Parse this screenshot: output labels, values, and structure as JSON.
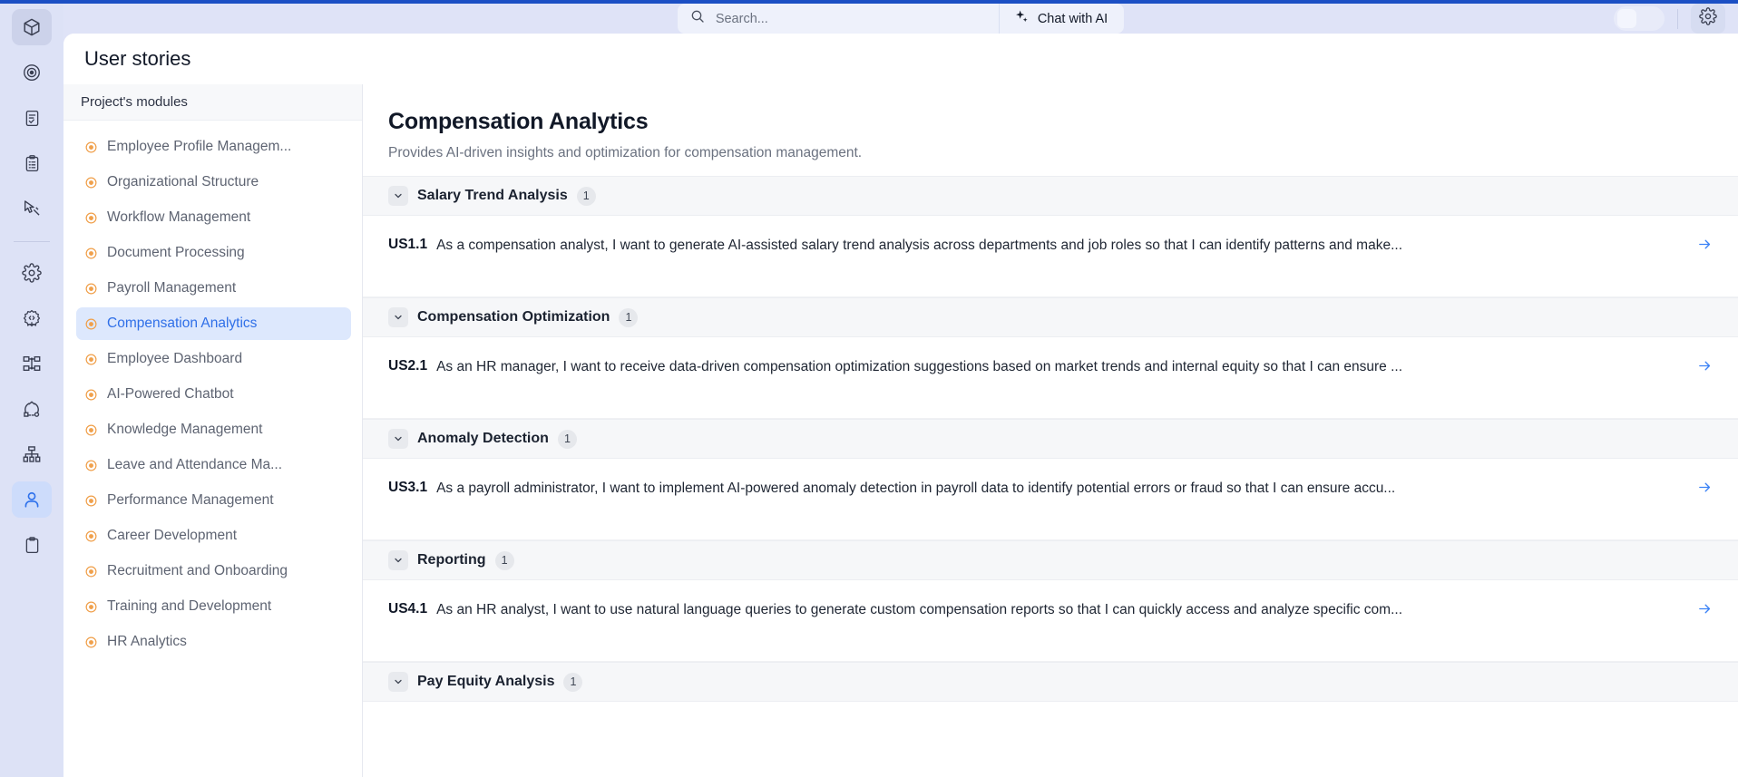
{
  "theme": {
    "accent_blue": "#2f6fe8",
    "rail_bg": "#dde2f6",
    "module_dot": "#f0a04b",
    "arrow_blue": "#3b82f6"
  },
  "topbar": {
    "search": {
      "placeholder": "Search...",
      "value": "",
      "icon": "search-icon"
    },
    "chat_ai": {
      "label": "Chat with AI",
      "icon": "sparkle-icon"
    },
    "theme_toggle": {
      "state": "off"
    },
    "settings": {
      "icon": "gear-icon"
    }
  },
  "rail": {
    "items": [
      {
        "icon": "cube-icon",
        "state": "active-grey"
      },
      {
        "icon": "target-icon",
        "state": "default"
      },
      {
        "icon": "document-check-icon",
        "state": "default"
      },
      {
        "icon": "clipboard-list-icon",
        "state": "default"
      },
      {
        "icon": "cursor-design-icon",
        "state": "default"
      },
      {
        "icon": "gear-icon",
        "state": "default"
      },
      {
        "icon": "code-node-icon",
        "state": "default"
      },
      {
        "icon": "flow-diagram-icon",
        "state": "default"
      },
      {
        "icon": "state-machine-icon",
        "state": "default"
      },
      {
        "icon": "hierarchy-icon",
        "state": "default"
      },
      {
        "icon": "user-icon",
        "state": "active-blue"
      },
      {
        "icon": "clipboard-icon",
        "state": "default"
      }
    ]
  },
  "page": {
    "title": "User stories"
  },
  "modules_panel": {
    "header": "Project's modules",
    "selected": "Compensation Analytics",
    "items": [
      {
        "label": "Employee Profile Managem..."
      },
      {
        "label": "Organizational Structure"
      },
      {
        "label": "Workflow Management"
      },
      {
        "label": "Document Processing"
      },
      {
        "label": "Payroll Management"
      },
      {
        "label": "Compensation Analytics"
      },
      {
        "label": "Employee Dashboard"
      },
      {
        "label": "AI-Powered Chatbot"
      },
      {
        "label": "Knowledge Management"
      },
      {
        "label": "Leave and Attendance Ma..."
      },
      {
        "label": "Performance Management"
      },
      {
        "label": "Career Development"
      },
      {
        "label": "Recruitment and Onboarding"
      },
      {
        "label": "Training and Development"
      },
      {
        "label": "HR Analytics"
      }
    ]
  },
  "module_detail": {
    "title": "Compensation Analytics",
    "description": "Provides AI-driven insights and optimization for compensation management.",
    "groups": [
      {
        "name": "Salary Trend Analysis",
        "count": "1",
        "expanded": true,
        "stories": [
          {
            "id": "US1.1",
            "text": "As a compensation analyst, I want to generate AI-assisted salary trend analysis across departments and job roles so that I can identify patterns and make..."
          }
        ]
      },
      {
        "name": "Compensation Optimization",
        "count": "1",
        "expanded": true,
        "stories": [
          {
            "id": "US2.1",
            "text": "As an HR manager, I want to receive data-driven compensation optimization suggestions based on market trends and internal equity so that I can ensure ..."
          }
        ]
      },
      {
        "name": "Anomaly Detection",
        "count": "1",
        "expanded": true,
        "stories": [
          {
            "id": "US3.1",
            "text": "As a payroll administrator, I want to implement AI-powered anomaly detection in payroll data to identify potential errors or fraud so that I can ensure accu..."
          }
        ]
      },
      {
        "name": "Reporting",
        "count": "1",
        "expanded": true,
        "stories": [
          {
            "id": "US4.1",
            "text": "As an HR analyst, I want to use natural language queries to generate custom compensation reports so that I can quickly access and analyze specific com..."
          }
        ]
      },
      {
        "name": "Pay Equity Analysis",
        "count": "1",
        "expanded": true,
        "stories": []
      }
    ]
  }
}
